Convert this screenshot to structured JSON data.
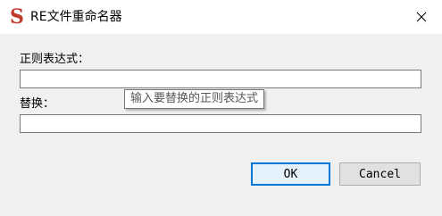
{
  "window": {
    "title": "RE文件重命名器",
    "app_icon_glyph": "S",
    "app_icon": "s-logo-icon",
    "close_icon": "close-icon"
  },
  "form": {
    "regex_label": "正则表达式：",
    "regex_value": "",
    "regex_tooltip": "输入要替换的正则表达式",
    "replace_label": "替换：",
    "replace_value": ""
  },
  "buttons": {
    "ok_label": "OK",
    "cancel_label": "Cancel"
  },
  "colors": {
    "accent": "#0078d7",
    "icon": "#c0392b"
  }
}
